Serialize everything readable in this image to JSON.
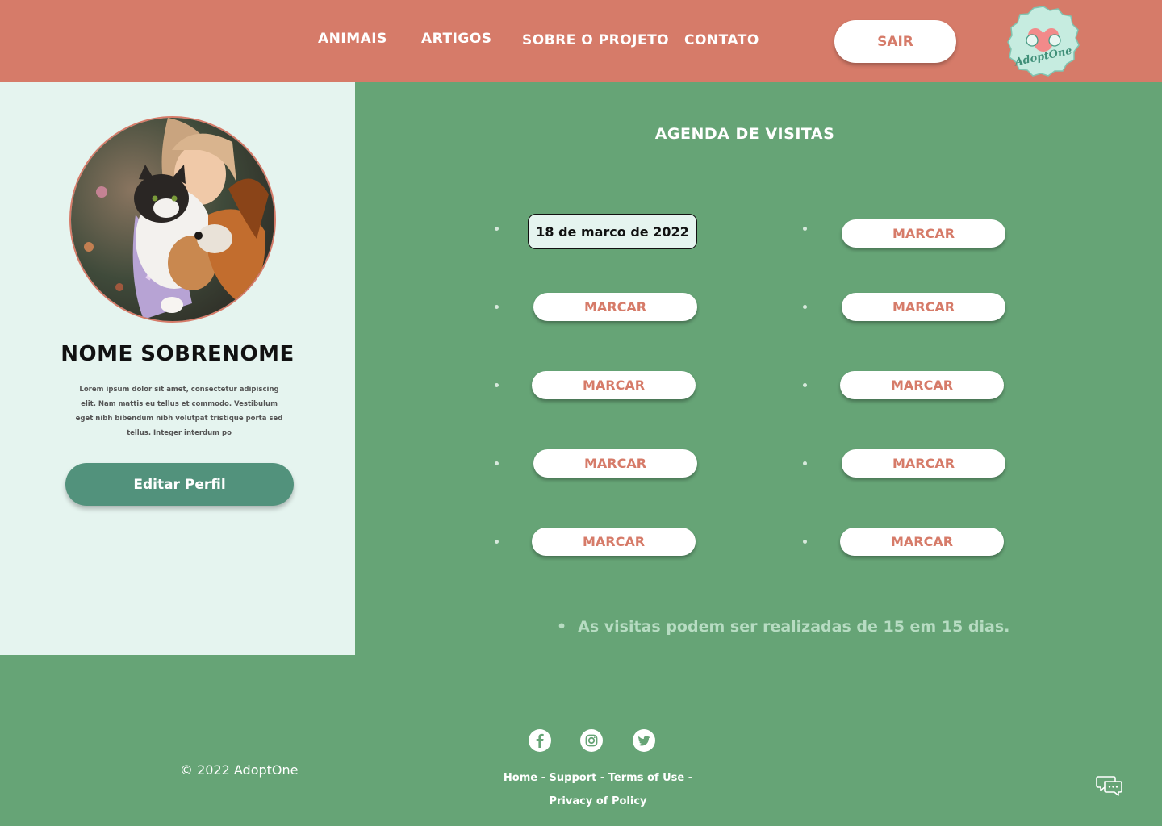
{
  "header": {
    "nav": [
      "ANIMAIS",
      "ARTIGOS",
      "SOBRE O PROJETO",
      "CONTATO"
    ],
    "logout_label": "SAIR",
    "logo_text": "AdoptOne"
  },
  "profile": {
    "name": "NOME SOBRENOME",
    "bio": "Lorem ipsum dolor sit amet, consectetur adipiscing elit. Nam mattis eu tellus et commodo. Vestibulum eget nibh bibendum nibh volutpat tristique porta sed tellus. Integer interdum po",
    "edit_label": "Editar Perfil"
  },
  "agenda": {
    "title": "AGENDA DE VISITAS",
    "selected_date": "18 de marco de 2022",
    "slot_label": "MARCAR",
    "note": "As visitas podem ser realizadas de 15 em 15 dias."
  },
  "footer": {
    "copyright": "© 2022 AdoptOne",
    "links": [
      "Home",
      "Support",
      "Terms of Use",
      "Privacy of Policy"
    ],
    "social_icons": [
      "facebook-icon",
      "instagram-icon",
      "twitter-icon"
    ],
    "chat_icon": "chat-icon"
  },
  "colors": {
    "header": "#d67b69",
    "sidebar": "#e5f4ef",
    "main": "#66a476",
    "button_green": "#52927c"
  }
}
